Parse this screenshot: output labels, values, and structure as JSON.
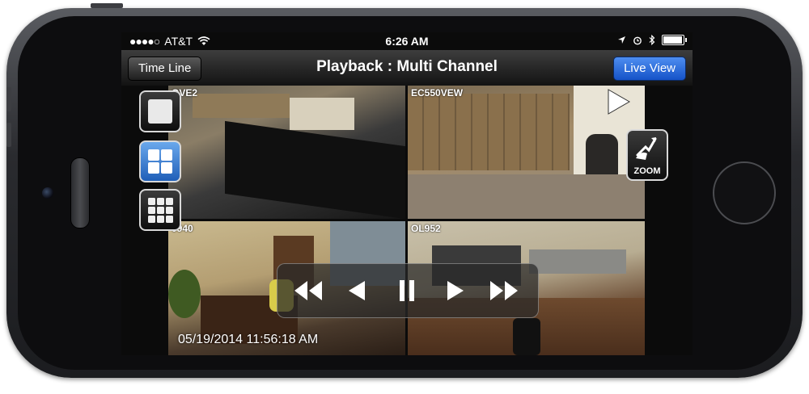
{
  "status_bar": {
    "carrier": "AT&T",
    "time": "6:26 AM",
    "signal_icon": "signal-dots-icon",
    "wifi_icon": "wifi-icon",
    "location_icon": "location-arrow-icon",
    "alarm_icon": "alarm-clock-icon",
    "bluetooth_icon": "bluetooth-icon",
    "battery_icon": "battery-icon"
  },
  "nav_bar": {
    "title": "Playback : Multi Channel",
    "left_button": "Time Line",
    "right_button": "Live View"
  },
  "cameras": [
    {
      "label": "OVE2"
    },
    {
      "label": "EC550VEW"
    },
    {
      "label": "0940"
    },
    {
      "label": "OL952"
    }
  ],
  "timestamp": "05/19/2014  11:56:18 AM",
  "layout_buttons": [
    {
      "icon": "single-view-icon",
      "active": false
    },
    {
      "icon": "quad-view-icon",
      "active": true
    },
    {
      "icon": "nine-grid-view-icon",
      "active": false
    }
  ],
  "zoom": {
    "label": "ZOOM",
    "icon": "zoom-gesture-icon"
  },
  "playback_controls": [
    "fast-rewind-icon",
    "step-back-icon",
    "pause-icon",
    "play-icon",
    "fast-forward-icon"
  ],
  "colors": {
    "live_view_blue": "#1f5fd0",
    "active_layout_blue": "#3a7fd6"
  }
}
